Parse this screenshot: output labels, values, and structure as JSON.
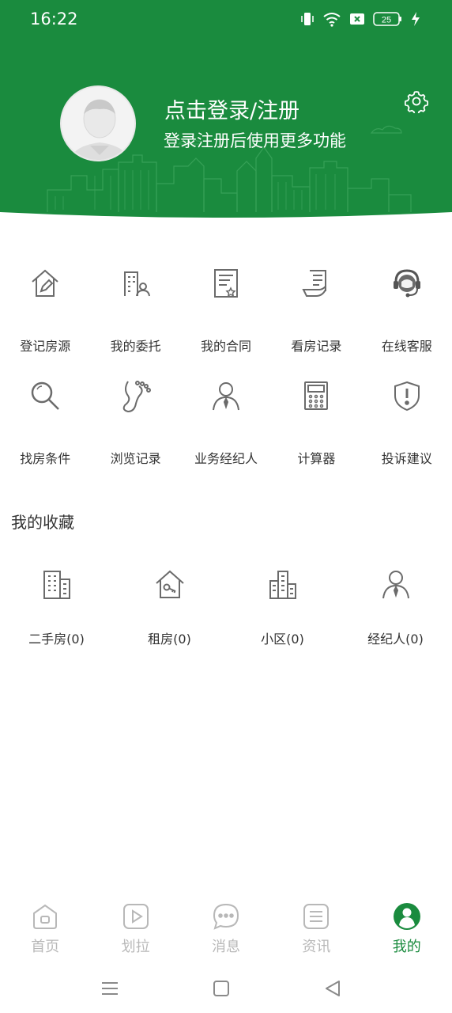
{
  "colors": {
    "brand_green": "#1a8b3e",
    "icon_gray": "#6b6b6b",
    "nav_inactive": "#b8b8b8"
  },
  "status_bar": {
    "time": "16:22",
    "battery": "25"
  },
  "header": {
    "login_title": "点击登录/注册",
    "login_subtitle": "登录注册后使用更多功能"
  },
  "services_row1": [
    {
      "label": "登记房源",
      "icon": "house-edit-icon"
    },
    {
      "label": "我的委托",
      "icon": "building-person-icon"
    },
    {
      "label": "我的合同",
      "icon": "contract-icon"
    },
    {
      "label": "看房记录",
      "icon": "viewing-record-icon"
    },
    {
      "label": "在线客服",
      "icon": "headset-icon"
    }
  ],
  "services_row2": [
    {
      "label": "找房条件",
      "icon": "search-icon"
    },
    {
      "label": "浏览记录",
      "icon": "footprint-icon"
    },
    {
      "label": "业务经纪人",
      "icon": "agent-icon"
    },
    {
      "label": "计算器",
      "icon": "calculator-icon"
    },
    {
      "label": "投诉建议",
      "icon": "shield-alert-icon"
    }
  ],
  "favorites": {
    "title": "我的收藏",
    "items": [
      {
        "label": "二手房(0)",
        "icon": "apartment-icon"
      },
      {
        "label": "租房(0)",
        "icon": "house-key-icon"
      },
      {
        "label": "小区(0)",
        "icon": "community-icon"
      },
      {
        "label": "经纪人(0)",
        "icon": "agent-icon"
      }
    ]
  },
  "bottom_nav": [
    {
      "label": "首页",
      "icon": "home-icon",
      "active": false
    },
    {
      "label": "划拉",
      "icon": "video-play-icon",
      "active": false
    },
    {
      "label": "消息",
      "icon": "chat-bubble-icon",
      "active": false
    },
    {
      "label": "资讯",
      "icon": "news-icon",
      "active": false
    },
    {
      "label": "我的",
      "icon": "profile-icon",
      "active": true
    }
  ]
}
